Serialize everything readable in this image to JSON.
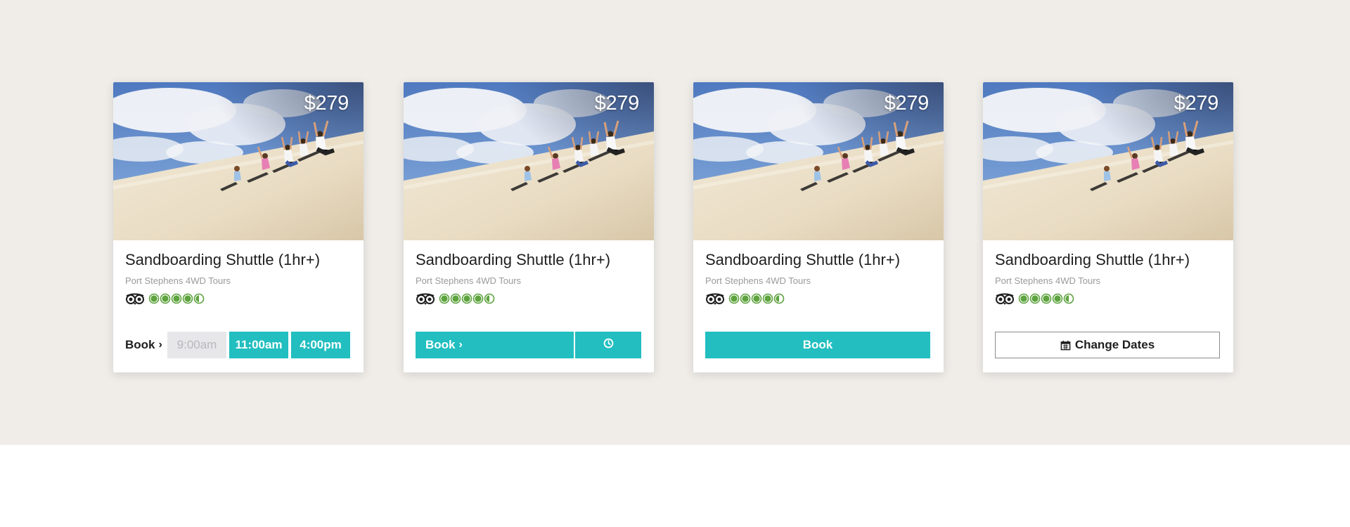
{
  "cards": [
    {
      "price": "$279",
      "title": "Sandboarding Shuttle (1hr+)",
      "operator": "Port Stephens 4WD Tours",
      "rating_icon": "tripadvisor-owl-icon",
      "rating": 4.5,
      "book_label": "Book",
      "times": [
        "9:00am",
        "11:00am",
        "4:00pm"
      ],
      "disabled_times": [
        "9:00am"
      ]
    },
    {
      "price": "$279",
      "title": "Sandboarding Shuttle (1hr+)",
      "operator": "Port Stephens 4WD Tours",
      "rating_icon": "tripadvisor-owl-icon",
      "rating": 4.5,
      "book_label": "Book",
      "secondary_icon": "clock-icon"
    },
    {
      "price": "$279",
      "title": "Sandboarding Shuttle (1hr+)",
      "operator": "Port Stephens 4WD Tours",
      "rating_icon": "tripadvisor-owl-icon",
      "rating": 4.5,
      "book_label": "Book"
    },
    {
      "price": "$279",
      "title": "Sandboarding Shuttle (1hr+)",
      "operator": "Port Stephens 4WD Tours",
      "rating_icon": "tripadvisor-owl-icon",
      "rating": 4.5,
      "change_dates_label": "Change Dates",
      "change_dates_icon": "calendar-icon"
    }
  ],
  "colors": {
    "accent": "#22bec0",
    "background_band": "#f0ede9",
    "rating_green": "#5ea33f",
    "disabled_bg": "#e7e7ea",
    "disabled_text": "#b9b9bd"
  }
}
